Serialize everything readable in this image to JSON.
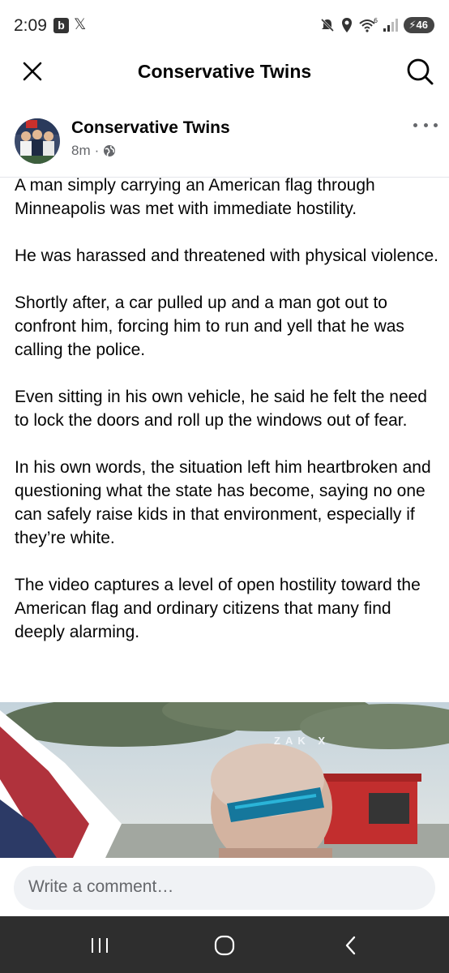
{
  "status_bar": {
    "time": "2:09",
    "badge": "b",
    "x_icon": "𝕏",
    "battery": "46"
  },
  "header": {
    "title": "Conservative Twins"
  },
  "post": {
    "author": "Conservative Twins",
    "time": "8m",
    "separator": "·",
    "paragraphs": [
      "A man simply carrying an American flag through Minneapolis was met with immediate hostility.",
      "He was harassed and threatened with physical violence.",
      "Shortly after, a car pulled up and a man got out to confront him, forcing him to run and yell that he was calling the police.",
      "Even sitting in his own vehicle, he said he felt the need to lock the doors and roll up the windows out of fear.",
      "In his own words, the situation left him heartbroken and questioning what the state has become, saying no one can safely raise kids in that environment, especially if they’re white.",
      "The video captures a level of open hostility toward the American flag and ordinary citizens that many find deeply alarming."
    ],
    "video_watermark": "ZAK X"
  },
  "composer": {
    "placeholder": "Write a comment…"
  },
  "icons": {
    "status": [
      "mute-icon",
      "location-icon",
      "wifi-icon",
      "signal-icon",
      "battery-icon"
    ],
    "header": [
      "close-icon",
      "search-icon"
    ],
    "post": [
      "globe-icon",
      "more-options-icon"
    ],
    "nav": [
      "recent-apps-icon",
      "home-icon",
      "back-icon"
    ]
  },
  "colors": {
    "text": "#050505",
    "secondary": "#65676b",
    "comment_bg": "#f0f2f5",
    "navbar": "#2e2e2e"
  }
}
